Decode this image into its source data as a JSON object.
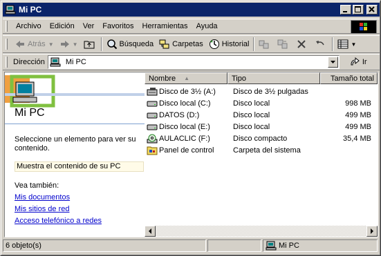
{
  "window": {
    "title": "Mi PC"
  },
  "menubar": {
    "items": [
      "Archivo",
      "Edición",
      "Ver",
      "Favoritos",
      "Herramientas",
      "Ayuda"
    ]
  },
  "toolbar": {
    "back_label": "Atrás",
    "search_label": "Búsqueda",
    "folders_label": "Carpetas",
    "history_label": "Historial"
  },
  "address": {
    "label": "Dirección",
    "value": "Mi PC",
    "go_label": "Ir"
  },
  "left_pane": {
    "title": "Mi PC",
    "description": "Seleccione un elemento para ver su contenido.",
    "info": "Muestra el contenido de su PC",
    "see_also": "Vea también:",
    "links": [
      "Mis documentos",
      "Mis sitios de red",
      "Acceso telefónico a redes"
    ]
  },
  "list": {
    "columns": {
      "name": "Nombre",
      "type": "Tipo",
      "size": "Tamaño total"
    },
    "rows": [
      {
        "name": "Disco de 3½ (A:)",
        "type": "Disco de 3½ pulgadas",
        "size": "",
        "icon": "floppy-icon"
      },
      {
        "name": "Disco local (C:)",
        "type": "Disco local",
        "size": "998 MB",
        "icon": "drive-icon"
      },
      {
        "name": "DATOS (D:)",
        "type": "Disco local",
        "size": "499 MB",
        "icon": "drive-icon"
      },
      {
        "name": "Disco local (E:)",
        "type": "Disco local",
        "size": "499 MB",
        "icon": "drive-icon"
      },
      {
        "name": "AULACLIC (F:)",
        "type": "Disco compacto",
        "size": "35,4 MB",
        "icon": "cd-icon"
      },
      {
        "name": "Panel de control",
        "type": "Carpeta del sistema",
        "size": "",
        "icon": "control-panel-icon"
      }
    ]
  },
  "statusbar": {
    "count": "6 objeto(s)",
    "location": "Mi PC"
  },
  "colors": {
    "titlebar": "#0a246a",
    "face": "#d4d0c8",
    "link": "#0000cc"
  }
}
